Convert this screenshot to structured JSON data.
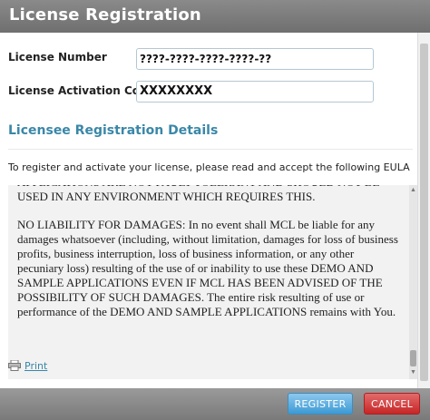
{
  "dialog": {
    "title": "License Registration"
  },
  "form": {
    "license_number_label": "License Number",
    "license_number_value": "????-????-????-????-??",
    "activation_code_label": "License Activation Code",
    "activation_code_value": "XXXXXXXX"
  },
  "section": {
    "title": "Licensee Registration Details",
    "intro": "To register and activate your license, please read and accept the following EULA"
  },
  "eula": {
    "paragraphs": [
      "APPLICATIONS ARE NOT FAULT TOLERANT AND SHOULD NOT BE USED IN ANY ENVIRONMENT WHICH REQUIRES THIS.",
      "NO LIABILITY FOR DAMAGES: In no event shall MCL be liable for any damages whatsoever (including, without limitation, damages for loss of business profits, business interruption, loss of business information, or any other pecuniary loss) resulting of the use of or inability to use these DEMO AND SAMPLE APPLICATIONS EVEN IF MCL HAS BEEN ADVISED OF THE POSSIBILITY OF SUCH DAMAGES. The entire risk resulting of use or performance of the DEMO AND SAMPLE APPLICATIONS remains with You."
    ]
  },
  "print": {
    "label": "Print",
    "icon": "printer-icon"
  },
  "buttons": {
    "register": "REGISTER",
    "cancel": "CANCEL"
  },
  "colors": {
    "accent": "#3a87a8",
    "register": "#3d9ad4",
    "cancel": "#c62626",
    "titlebar": "#7a7a7a"
  }
}
